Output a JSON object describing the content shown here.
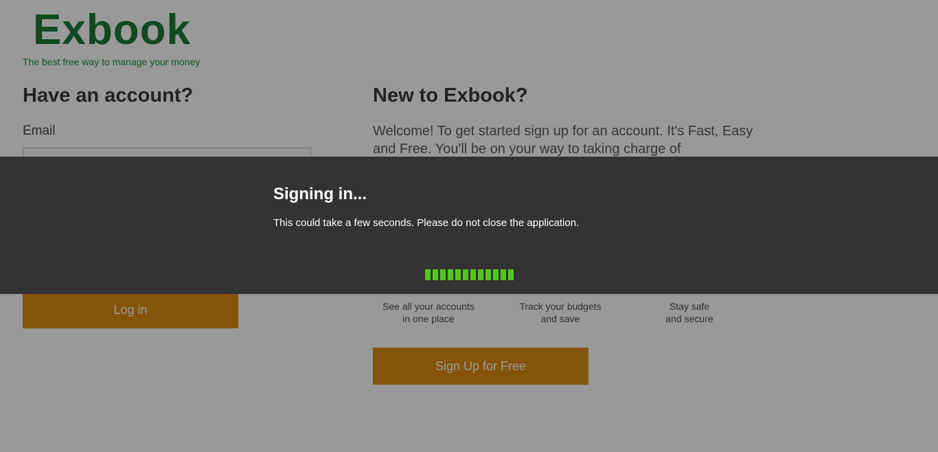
{
  "brand": {
    "name": "Exbook",
    "tagline": "The best free way to manage your money",
    "color": "#1d7a3a"
  },
  "login": {
    "heading": "Have an account?",
    "email_label": "Email",
    "email_value": "",
    "button_label": "Log in"
  },
  "signup": {
    "heading": "New to Exbook?",
    "welcome_text": "Welcome! To get started sign up for an account. It's Fast, Easy and Free. You'll be on your way to taking charge of",
    "features": [
      {
        "line1": "See all your accounts",
        "line2": "in one place"
      },
      {
        "line1": "Track your budgets",
        "line2": "and save"
      },
      {
        "line1": "Stay safe",
        "line2": "and secure"
      }
    ],
    "button_label": "Sign Up for Free"
  },
  "overlay": {
    "title": "Signing in...",
    "message": "This could take a few seconds. Please do not close the application.",
    "progress_segments": 12,
    "progress_color": "#53c51d",
    "background": "#333333"
  },
  "colors": {
    "accent_button": "#dd8d12"
  }
}
